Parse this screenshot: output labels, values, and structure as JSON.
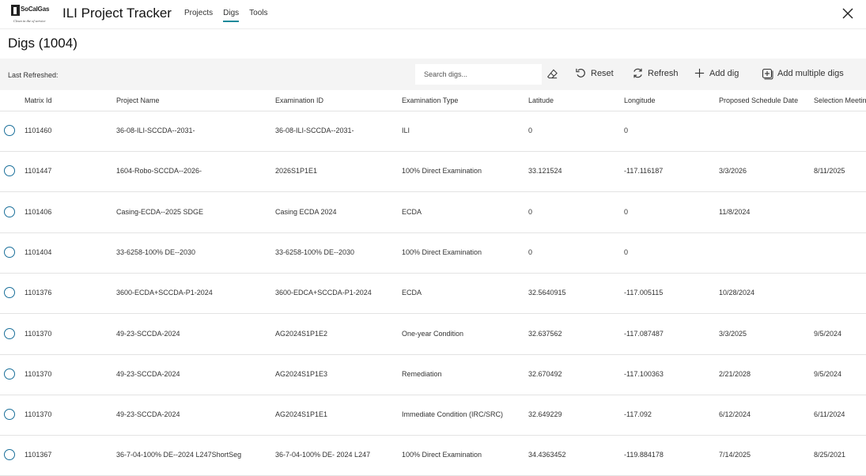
{
  "app": {
    "logo_brand": "SoCalGas",
    "logo_tagline": "Clean in the of service",
    "title": "ILI Project Tracker",
    "nav": [
      "Projects",
      "Digs",
      "Tools"
    ],
    "active_tab": "Digs",
    "accent_color": "#1a8a9a"
  },
  "page": {
    "title": "Digs (1004)"
  },
  "toolbar": {
    "last_refreshed_label": "Last Refreshed:",
    "search_placeholder": "Search digs...",
    "clear_icon": "eraser-icon",
    "reset_label": "Reset",
    "refresh_label": "Refresh",
    "add_dig_label": "Add dig",
    "add_multiple_label": "Add multiple digs"
  },
  "table": {
    "columns": [
      "Matrix Id",
      "Project Name",
      "Examination ID",
      "Examination Type",
      "Latitude",
      "Longitude",
      "Proposed Schedule Date",
      "Selection Meeting"
    ],
    "rows": [
      [
        "1101460",
        "36-08-ILI-SCCDA--2031-",
        "36-08-ILI-SCCDA--2031-",
        "ILI",
        "0",
        "0",
        "",
        ""
      ],
      [
        "1101447",
        "1604-Robo-SCCDA--2026-",
        "2026S1P1E1",
        "100% Direct Examination",
        "33.121524",
        "-117.116187",
        "3/3/2026",
        "8/11/2025"
      ],
      [
        "1101406",
        "Casing-ECDA--2025 SDGE",
        "Casing ECDA 2024",
        "ECDA",
        "0",
        "0",
        "11/8/2024",
        ""
      ],
      [
        "1101404",
        "33-6258-100% DE--2030",
        "33-6258-100% DE--2030",
        "100% Direct Examination",
        "0",
        "0",
        "",
        ""
      ],
      [
        "1101376",
        "3600-ECDA+SCCDA-P1-2024",
        "3600-EDCA+SCCDA-P1-2024",
        "ECDA",
        "32.5640915",
        "-117.005115",
        "10/28/2024",
        ""
      ],
      [
        "1101370",
        "49-23-SCCDA-2024",
        "AG2024S1P1E2",
        "One-year Condition",
        "32.637562",
        "-117.087487",
        "3/3/2025",
        "9/5/2024"
      ],
      [
        "1101370",
        "49-23-SCCDA-2024",
        "AG2024S1P1E3",
        "Remediation",
        "32.670492",
        "-117.100363",
        "2/21/2028",
        "9/5/2024"
      ],
      [
        "1101370",
        "49-23-SCCDA-2024",
        "AG2024S1P1E1",
        "Immediate Condition (IRC/SRC)",
        "32.649229",
        "-117.092",
        "6/12/2024",
        "6/11/2024"
      ],
      [
        "1101367",
        "36-7-04-100% DE--2024 L247ShortSeg",
        "36-7-04-100% DE- 2024 L247",
        "100% Direct Examination",
        "34.4363452",
        "-119.884178",
        "7/14/2025",
        "8/25/2021"
      ]
    ]
  }
}
